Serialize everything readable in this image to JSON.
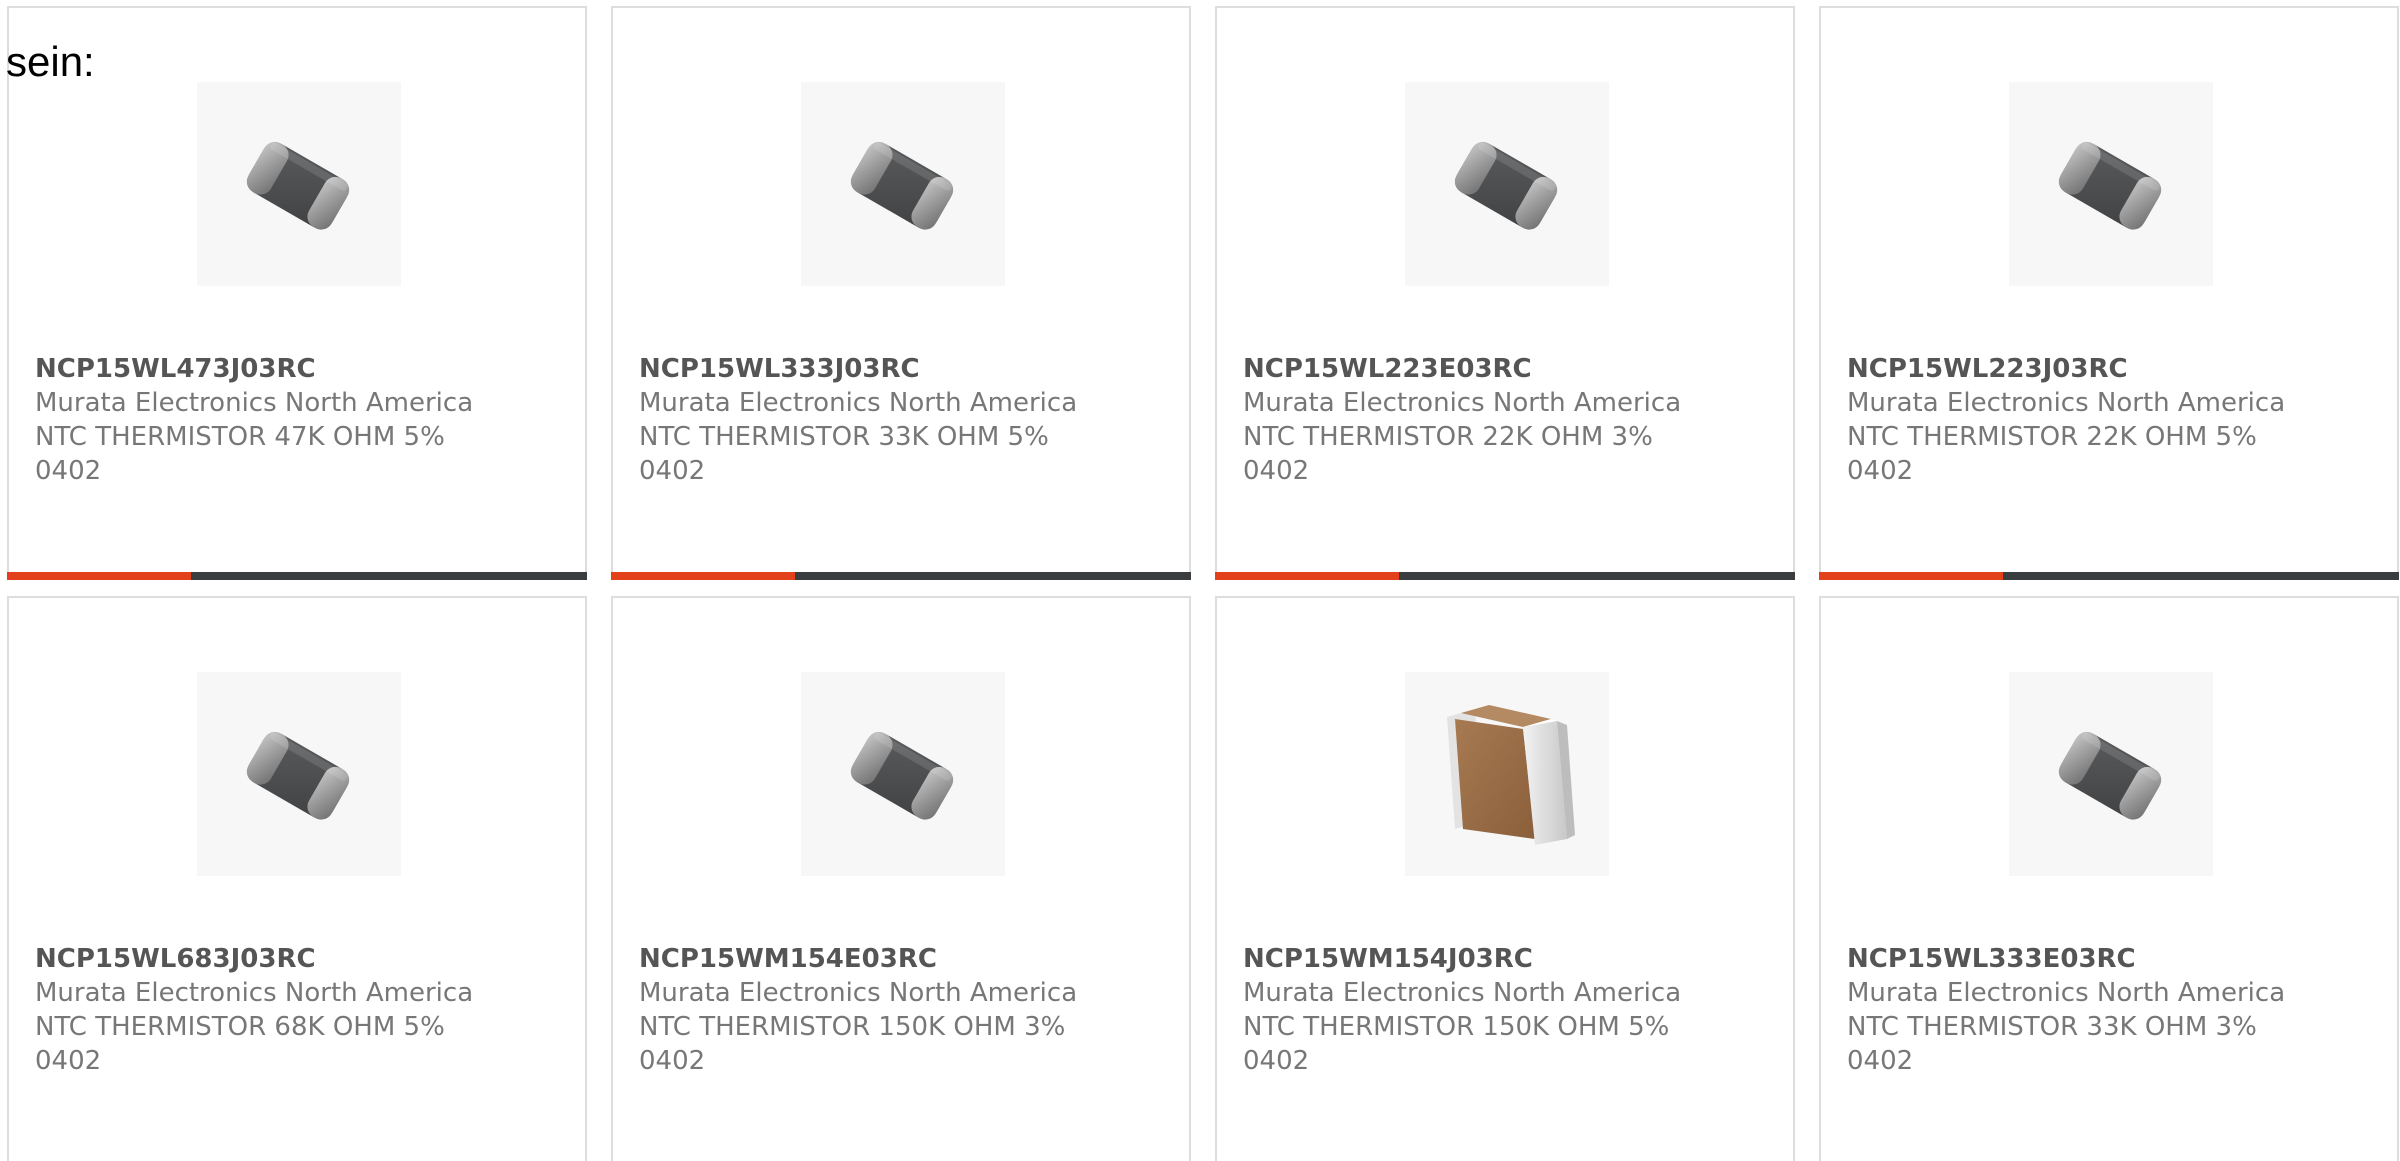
{
  "lead_text": "sein:",
  "colors": {
    "accent": "#e3411b",
    "bar": "#3a3d3f",
    "part_number_text": "#555555",
    "body_text": "#777777",
    "card_border": "#dddddd"
  },
  "products": [
    {
      "part_number": "NCP15WL473J03RC",
      "manufacturer": "Murata Electronics North America",
      "description": "NTC THERMISTOR 47K OHM 5% 0402",
      "image": "gray-smd-thermistor-image"
    },
    {
      "part_number": "NCP15WL333J03RC",
      "manufacturer": "Murata Electronics North America",
      "description": "NTC THERMISTOR 33K OHM 5% 0402",
      "image": "gray-smd-thermistor-image"
    },
    {
      "part_number": "NCP15WL223E03RC",
      "manufacturer": "Murata Electronics North America",
      "description": "NTC THERMISTOR 22K OHM 3% 0402",
      "image": "gray-smd-thermistor-image"
    },
    {
      "part_number": "NCP15WL223J03RC",
      "manufacturer": "Murata Electronics North America",
      "description": "NTC THERMISTOR 22K OHM 5% 0402",
      "image": "gray-smd-thermistor-image"
    },
    {
      "part_number": "NCP15WL683J03RC",
      "manufacturer": "Murata Electronics North America",
      "description": "NTC THERMISTOR 68K OHM 5% 0402",
      "image": "gray-smd-thermistor-image"
    },
    {
      "part_number": "NCP15WM154E03RC",
      "manufacturer": "Murata Electronics North America",
      "description": "NTC THERMISTOR 150K OHM 3% 0402",
      "image": "gray-smd-thermistor-image"
    },
    {
      "part_number": "NCP15WM154J03RC",
      "manufacturer": "Murata Electronics North America",
      "description": "NTC THERMISTOR 150K OHM 5% 0402",
      "image": "brown-smd-component-image"
    },
    {
      "part_number": "NCP15WL333E03RC",
      "manufacturer": "Murata Electronics North America",
      "description": "NTC THERMISTOR 33K OHM 3% 0402",
      "image": "gray-smd-thermistor-image"
    }
  ]
}
